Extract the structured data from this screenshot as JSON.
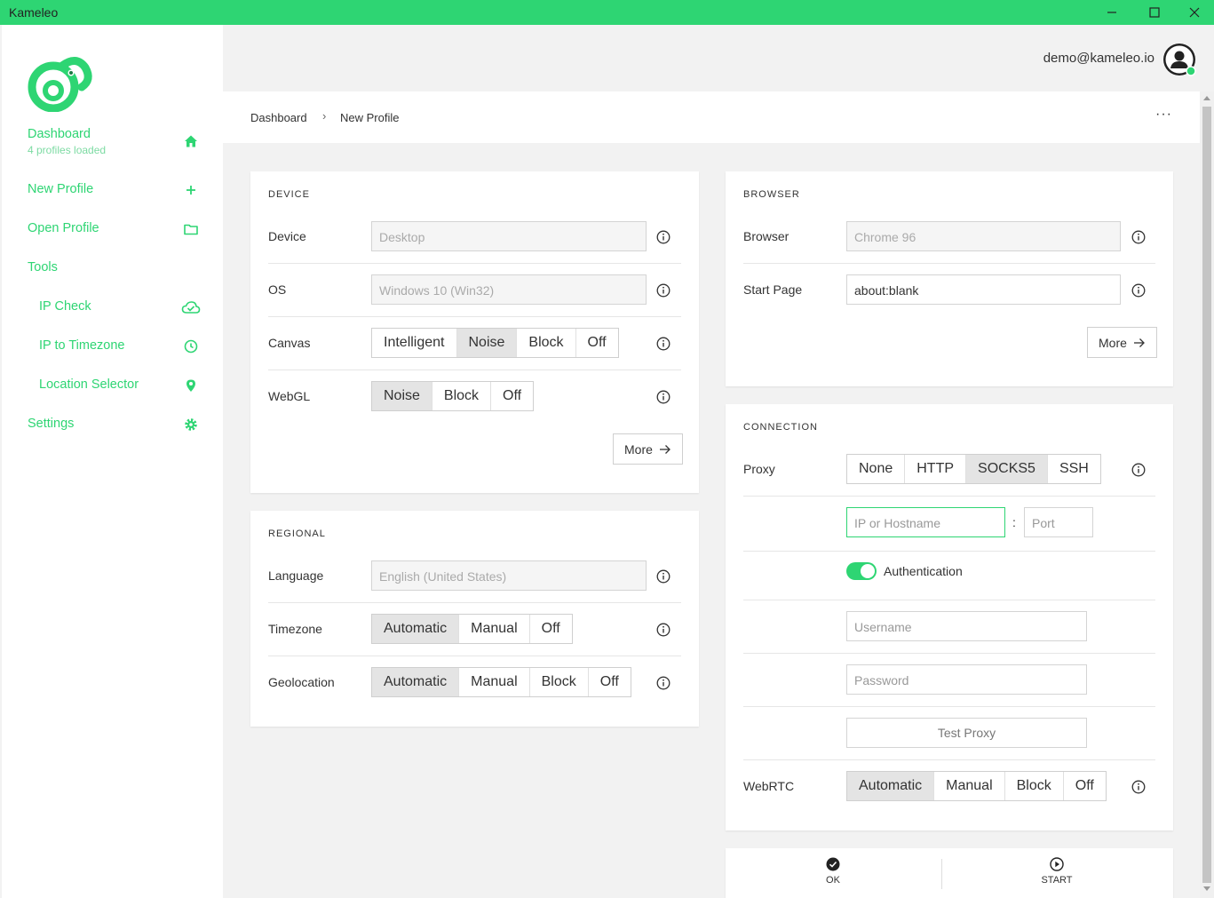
{
  "window": {
    "title": "Kameleo",
    "controls": [
      "minimize-icon",
      "maximize-icon",
      "close-icon"
    ]
  },
  "colors": {
    "accent": "#2ed573",
    "titlebar": "#2ed573"
  },
  "sidebar": {
    "items": [
      {
        "label": "Dashboard",
        "sub": "4 profiles loaded",
        "icon": "home-icon"
      },
      {
        "label": "New Profile",
        "icon": "plus-icon"
      },
      {
        "label": "Open Profile",
        "icon": "folder-icon"
      },
      {
        "label": "Tools"
      },
      {
        "label": "IP Check",
        "icon": "cloud-check-icon"
      },
      {
        "label": "IP to Timezone",
        "icon": "clock-icon"
      },
      {
        "label": "Location Selector",
        "icon": "map-pin-icon"
      },
      {
        "label": "Settings",
        "icon": "gear-icon"
      }
    ]
  },
  "user": {
    "email": "demo@kameleo.io"
  },
  "breadcrumb": {
    "items": [
      "Dashboard",
      "New Profile"
    ],
    "separator": "›",
    "more": "···"
  },
  "device": {
    "title": "DEVICE",
    "device": {
      "label": "Device",
      "value": "Desktop"
    },
    "os": {
      "label": "OS",
      "value": "Windows 10 (Win32)"
    },
    "canvas": {
      "label": "Canvas",
      "options": [
        "Intelligent",
        "Noise",
        "Block",
        "Off"
      ],
      "selected": "Noise"
    },
    "webgl": {
      "label": "WebGL",
      "options": [
        "Noise",
        "Block",
        "Off"
      ],
      "selected": "Noise"
    },
    "more": "More"
  },
  "regional": {
    "title": "REGIONAL",
    "language": {
      "label": "Language",
      "value": "English (United States)"
    },
    "timezone": {
      "label": "Timezone",
      "options": [
        "Automatic",
        "Manual",
        "Off"
      ],
      "selected": "Automatic"
    },
    "geolocation": {
      "label": "Geolocation",
      "options": [
        "Automatic",
        "Manual",
        "Block",
        "Off"
      ],
      "selected": "Automatic"
    }
  },
  "browser": {
    "title": "BROWSER",
    "browser": {
      "label": "Browser",
      "value": "Chrome 96"
    },
    "start_page": {
      "label": "Start Page",
      "value": "about:blank"
    },
    "more": "More"
  },
  "connection": {
    "title": "CONNECTION",
    "proxy": {
      "label": "Proxy",
      "options": [
        "None",
        "HTTP",
        "SOCKS5",
        "SSH"
      ],
      "selected": "SOCKS5"
    },
    "host_placeholder": "IP or Hostname",
    "colon": ":",
    "port_placeholder": "Port",
    "authentication": {
      "label": "Authentication",
      "enabled": true
    },
    "username_placeholder": "Username",
    "password_placeholder": "Password",
    "test_proxy": "Test Proxy",
    "webrtc": {
      "label": "WebRTC",
      "options": [
        "Automatic",
        "Manual",
        "Block",
        "Off"
      ],
      "selected": "Automatic"
    }
  },
  "actions": {
    "ok": "OK",
    "start": "START"
  }
}
